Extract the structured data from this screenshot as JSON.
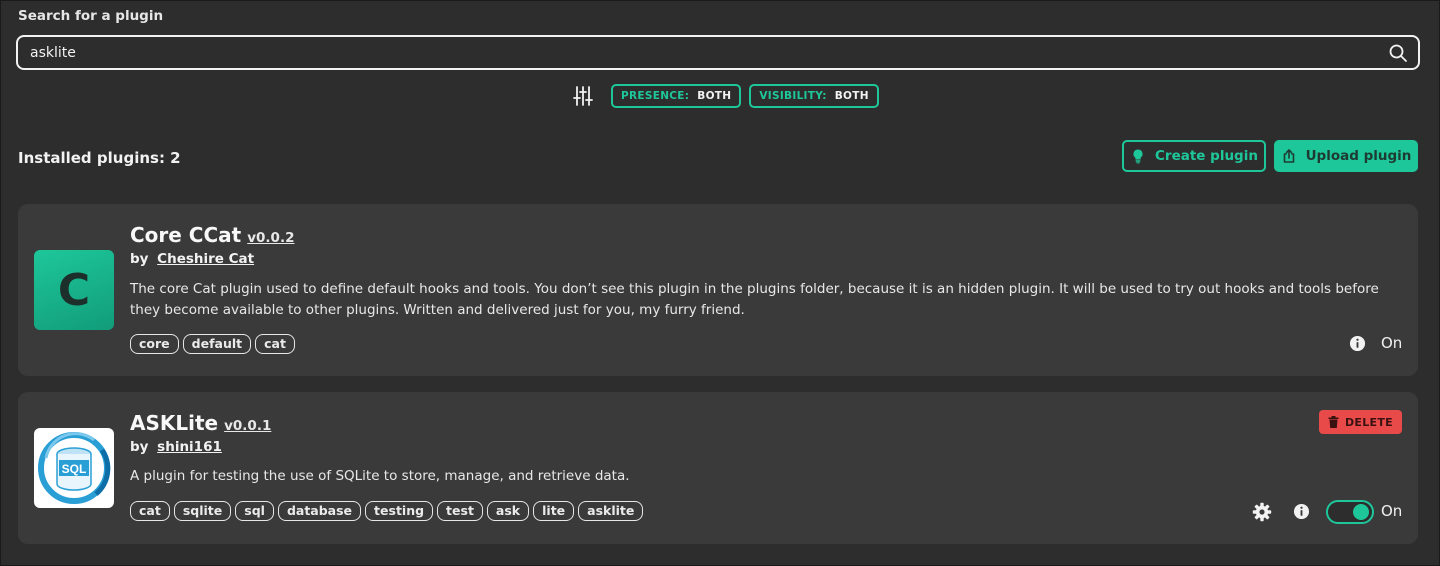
{
  "search": {
    "label": "Search for a plugin",
    "value": "asklite",
    "placeholder": ""
  },
  "filters": [
    {
      "key": "PRESENCE:",
      "value": "BOTH"
    },
    {
      "key": "VISIBILITY:",
      "value": "BOTH"
    }
  ],
  "installed_label": "Installed plugins: 2",
  "actions": {
    "create": "Create plugin",
    "upload": "Upload plugin"
  },
  "plugins": [
    {
      "logo_letter": "C",
      "name": "Core CCat",
      "version": "v0.0.2",
      "by": "by",
      "author": "Cheshire Cat",
      "description": "The core Cat plugin used to define default hooks and tools. You don’t see this plugin in the plugins folder, because it is an hidden plugin. It will be used to try out hooks and tools before they become available to other plugins. Written and delivered just for you, my furry friend.",
      "tags": [
        "core",
        "default",
        "cat"
      ],
      "state": "On"
    },
    {
      "logo_text": "SQL",
      "name": "ASKLite",
      "version": "v0.0.1",
      "by": "by",
      "author": "shini161",
      "description": "A plugin for testing the use of SQLite to store, manage, and retrieve data.",
      "tags": [
        "cat",
        "sqlite",
        "sql",
        "database",
        "testing",
        "test",
        "ask",
        "lite",
        "asklite"
      ],
      "state": "On",
      "enabled": true,
      "delete_label": "DELETE"
    }
  ],
  "colors": {
    "accent": "#1ec79a",
    "background": "#2d2d2d",
    "card": "#3a3a3a",
    "danger": "#e84a4a"
  }
}
